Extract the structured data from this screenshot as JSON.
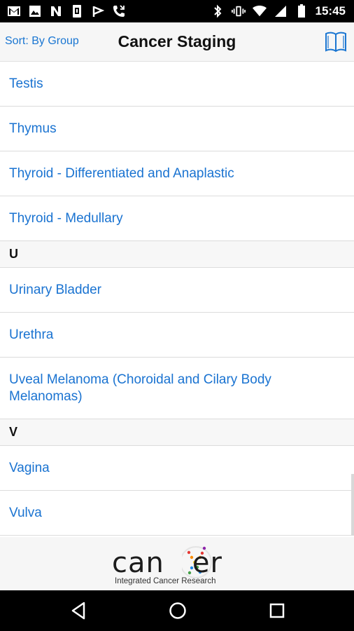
{
  "status_bar": {
    "time": "15:45",
    "left_icons": [
      "gmail-icon",
      "image-icon",
      "n-app-icon",
      "sim-icon",
      "flag-icon",
      "missed-call-icon"
    ],
    "right_icons": [
      "bluetooth-icon",
      "vibrate-icon",
      "wifi-icon",
      "cell-signal-icon",
      "battery-icon"
    ]
  },
  "header": {
    "sort_label": "Sort: By Group",
    "title": "Cancer Staging",
    "book_icon": "book-icon"
  },
  "list": [
    {
      "type": "item",
      "label": "Testis"
    },
    {
      "type": "item",
      "label": "Thymus"
    },
    {
      "type": "item",
      "label": "Thyroid - Differentiated and Anaplastic"
    },
    {
      "type": "item",
      "label": "Thyroid - Medullary"
    },
    {
      "type": "section",
      "label": "U"
    },
    {
      "type": "item",
      "label": "Urinary Bladder"
    },
    {
      "type": "item",
      "label": "Urethra"
    },
    {
      "type": "item",
      "label": "Uveal Melanoma (Choroidal and Cilary Body Melanomas)"
    },
    {
      "type": "section",
      "label": "V"
    },
    {
      "type": "item",
      "label": "Vagina"
    },
    {
      "type": "item",
      "label": "Vulva"
    }
  ],
  "footer": {
    "logo_text": "canxer",
    "tagline": "Integrated Cancer Research"
  },
  "colors": {
    "link": "#1a73d1",
    "header_bg": "#f6f6f6",
    "section_bg": "#f7f7f7"
  }
}
